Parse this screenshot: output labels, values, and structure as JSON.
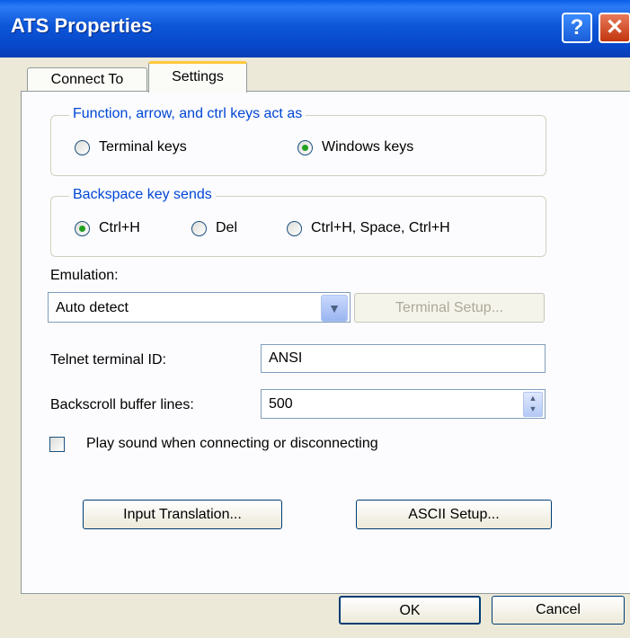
{
  "window": {
    "title": "ATS Properties",
    "help_glyph": "?",
    "close_glyph": "✕"
  },
  "tabs": [
    {
      "label": "Connect To",
      "active": false
    },
    {
      "label": "Settings",
      "active": true
    }
  ],
  "function_keys": {
    "label": "Function, arrow, and ctrl keys act as",
    "options": [
      {
        "label": "Terminal keys",
        "selected": false
      },
      {
        "label": "Windows keys",
        "selected": true
      }
    ]
  },
  "backspace": {
    "label": "Backspace key sends",
    "options": [
      {
        "label": "Ctrl+H",
        "selected": true
      },
      {
        "label": "Del",
        "selected": false
      },
      {
        "label": "Ctrl+H, Space, Ctrl+H",
        "selected": false
      }
    ]
  },
  "emulation": {
    "label": "Emulation:",
    "value": "Auto detect",
    "setup_button": "Terminal Setup..."
  },
  "telnet": {
    "label": "Telnet terminal ID:",
    "value": "ANSI"
  },
  "backscroll": {
    "label": "Backscroll buffer lines:",
    "value": "500"
  },
  "sound": {
    "label": "Play sound when connecting or disconnecting",
    "checked": false
  },
  "buttons": {
    "input_translation": "Input Translation...",
    "ascii_setup": "ASCII Setup...",
    "ok": "OK",
    "cancel": "Cancel"
  },
  "colors": {
    "titlebar": "#0a55e0",
    "group_label": "#0046d5",
    "radio_selected": "#21a121",
    "tab_highlight": "#ffc83c",
    "dialog_bg": "#ece9d8"
  }
}
